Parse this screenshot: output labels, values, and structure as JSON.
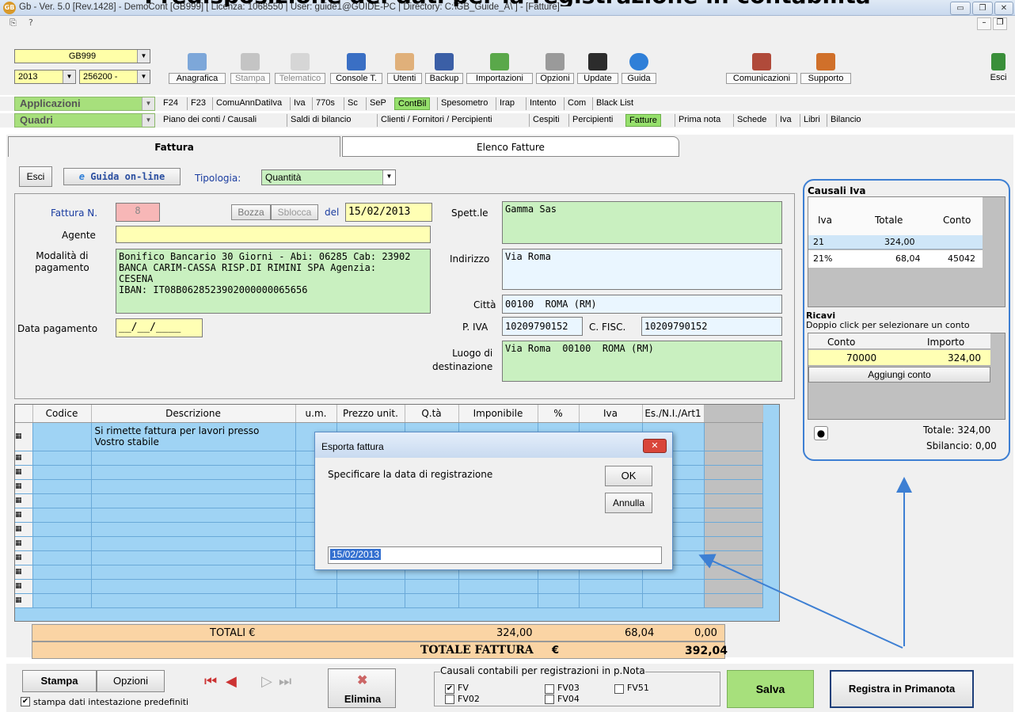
{
  "heading": "Predisposizione dei dati per la registrazione in contabilità",
  "window": {
    "title": "Gb - Ver. 5.0 [Rev.1428] - DemoCont [GB999]    [ Licenza: 1068550 | User: guide1@GUIDE-PC | Directory: C:\\GB_Guide_A\\ ] - [Fatture]",
    "menu_help": "?"
  },
  "toolbar": {
    "company": "GB999",
    "year": "2013",
    "code": "256200 -",
    "buttons": [
      "Anagrafica",
      "Stampa",
      "Telematico",
      "Console T.",
      "Utenti",
      "Backup",
      "Importazioni",
      "Opzioni",
      "Update",
      "Guida"
    ],
    "right_buttons": [
      "Comunicazioni",
      "Supporto"
    ],
    "exit": "Esci"
  },
  "nav": {
    "applicazioni_label": "Applicazioni",
    "applicazioni": [
      "F24",
      "F23",
      "ComuAnnDatiIva",
      "Iva",
      "770s",
      "Sc",
      "SeP",
      "ContBil",
      "Spesometro",
      "Irap",
      "Intento",
      "Com",
      "Black List"
    ],
    "quadri_label": "Quadri",
    "quadri": [
      "Piano dei conti / Causali",
      "Saldi di bilancio",
      "Clienti / Fornitori / Percipienti",
      "Cespiti",
      "Percipienti",
      "Fatture",
      "Prima nota",
      "Schede",
      "Iva",
      "Libri",
      "Bilancio"
    ]
  },
  "tabs": {
    "fattura": "Fattura",
    "elenco": "Elenco Fatture"
  },
  "form": {
    "esci": "Esci",
    "guida": "Guida on-line",
    "tipologia_label": "Tipologia:",
    "tipologia_value": "Quantità",
    "fattura_n_label": "Fattura N.",
    "fattura_n": "8",
    "bozza": "Bozza",
    "sblocca": "Sblocca",
    "del_label": "del",
    "data": "15/02/2013",
    "agente_label": "Agente",
    "modalita_label": "Modalità di\npagamento",
    "modalita": "Bonifico Bancario 30 Giorni - Abi: 06285 Cab: 23902\nBANCA CARIM-CASSA RISP.DI RIMINI SPA Agenzia:\nCESENA\nIBAN: IT08B0628523902000000065656",
    "data_pag_label": "Data pagamento",
    "data_pag": "__/__/____",
    "spett_label": "Spett.le",
    "spett": "Gamma Sas",
    "indirizzo_label": "Indirizzo",
    "indirizzo": "Via Roma",
    "citta_label": "Città",
    "citta": "00100  ROMA (RM)",
    "piva_label": "P. IVA",
    "piva": "10209790152",
    "cfisc_label": "C. FISC.",
    "cfisc": "10209790152",
    "luogo_label": "Luogo di\ndestinazione",
    "luogo": "Via Roma  00100  ROMA (RM)"
  },
  "causali_iva": {
    "title": "Causali Iva",
    "headers": [
      "Iva",
      "Totale",
      "Conto"
    ],
    "rows": [
      [
        "21",
        "324,00",
        ""
      ],
      [
        "21%",
        "68,04",
        "45042"
      ]
    ]
  },
  "ricavi": {
    "title": "Ricavi",
    "hint": "Doppio click per selezionare un conto",
    "headers": [
      "Conto",
      "Importo"
    ],
    "row": [
      "70000",
      "324,00"
    ],
    "add": "Aggiungi conto",
    "totale": "Totale: 324,00",
    "sbilancio": "Sbilancio: 0,00"
  },
  "grid": {
    "headers": [
      "Codice",
      "Descrizione",
      "u.m.",
      "Prezzo unit.",
      "Q.tà",
      "Imponibile",
      "%",
      "Iva",
      "Es./N.I./Art1"
    ],
    "row1_desc": "Si rimette fattura per lavori presso\nVostro stabile"
  },
  "totals": {
    "label": "TOTALI  €",
    "imponibile": "324,00",
    "iva": "68,04",
    "es": "0,00",
    "fattura_label": "TOTALE FATTURA",
    "euro": "€",
    "fattura": "392,04"
  },
  "dialog": {
    "title": "Esporta fattura",
    "message": "Specificare la data di registrazione",
    "ok": "OK",
    "annulla": "Annulla",
    "value": "15/02/2013"
  },
  "bottom": {
    "stampa": "Stampa",
    "opzioni": "Opzioni",
    "stampa_check": "stampa dati intestazione predefiniti",
    "elimina": "Elimina",
    "causali_title": "Causali contabili per registrazioni in p.Nota",
    "checks": [
      [
        "FV",
        true
      ],
      [
        "FV02",
        false
      ],
      [
        "FV03",
        false
      ],
      [
        "FV04",
        false
      ],
      [
        "FV51",
        false
      ]
    ],
    "salva": "Salva",
    "registra": "Registra in Primanota"
  },
  "colors": {
    "accent_green": "#96e06c",
    "field_green": "#c9f0c0",
    "field_yellow": "#ffffb4",
    "grid_blue": "#9fd3f4",
    "total_orange": "#fad4a4",
    "callout_blue": "#3d7fd3"
  }
}
